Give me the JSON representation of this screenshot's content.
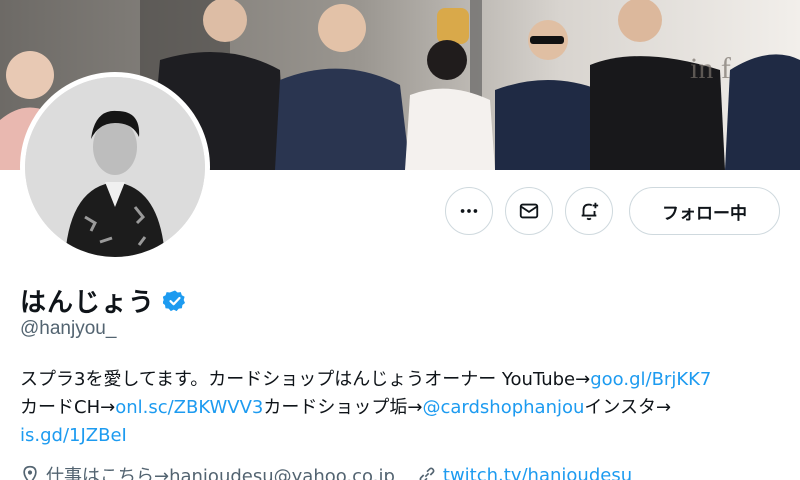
{
  "profile": {
    "display_name": "はんじょう",
    "handle": "@hanjyou_",
    "follow_label": "フォロー中"
  },
  "icons": {
    "more": "more-horizontal-icon",
    "message": "envelope-icon",
    "notify": "bell-plus-icon",
    "verified": "verified-badge-icon",
    "location": "location-pin-icon",
    "link": "link-icon"
  },
  "bio": {
    "line1_text": "スプラ3を愛してます。カードショップはんじょうオーナー YouTube→",
    "line1_link": "goo.gl/BrjKK7",
    "line2_text_a": "カードCH→",
    "line2_link_a": "onl.sc/ZBKWVV3",
    "line2_text_b": "カードショップ垢→",
    "line2_link_b": "@cardshophanjou",
    "line2_text_c": "インスタ→",
    "line3_link": "is.gd/1JZBeI"
  },
  "meta": {
    "location": "仕事はこちら→hanjoudesu@yahoo.co.jp",
    "website": "twitch.tv/hanjoudesu"
  },
  "colors": {
    "link": "#1d9bf0",
    "verified": "#1d9bf0",
    "text": "#0f1419",
    "secondary": "#536471",
    "border": "#cfd9de"
  }
}
